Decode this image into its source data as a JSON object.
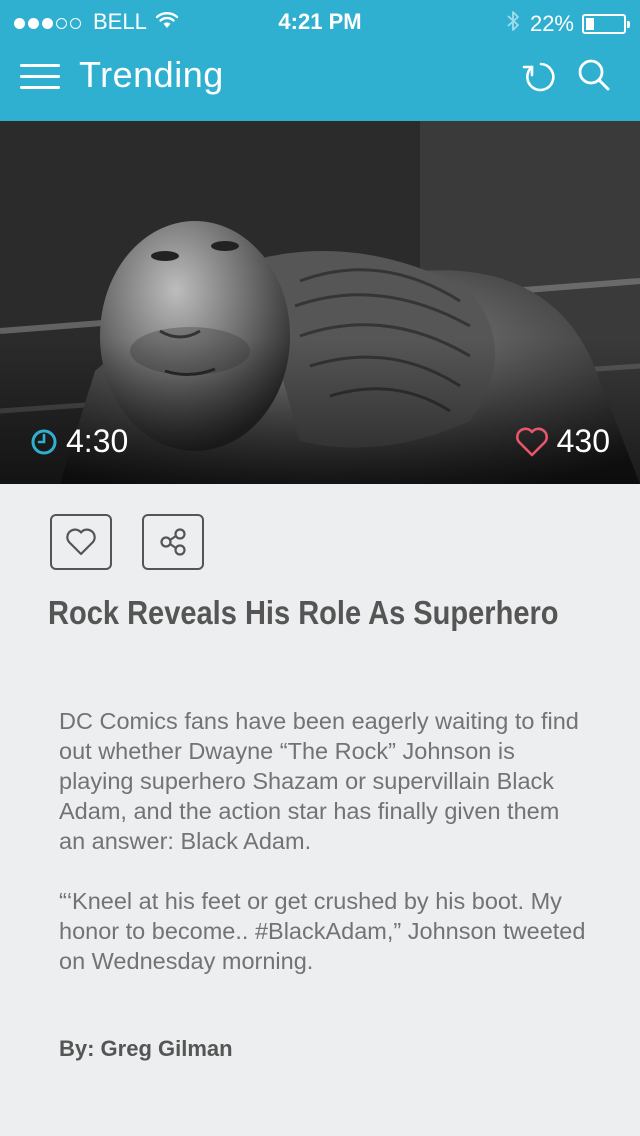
{
  "status_bar": {
    "carrier": "BELL",
    "time": "4:21 PM",
    "battery_percent": "22%",
    "battery_level": 0.22,
    "signal_bars": 3,
    "signal_max": 5,
    "icons": [
      "signal-dots-icon",
      "wifi-icon",
      "bluetooth-icon",
      "battery-icon"
    ]
  },
  "navbar": {
    "title": "Trending",
    "icons": [
      "menu-icon",
      "refresh-icon",
      "search-icon"
    ]
  },
  "article": {
    "duration": "4:30",
    "likes": "430",
    "title": "Rock Reveals His Role As Superhero",
    "paragraphs": [
      "DC Comics fans have been eagerly waiting to find out whether Dwayne “The Rock” Johnson is playing superhero Shazam or supervillain Black Adam, and the action star has finally given them an answer: Black Adam.",
      "“‘Kneel at his feet or get crushed by his boot. My honor to become.. #BlackAdam,” Johnson tweeted on Wednesday morning."
    ],
    "author": "By: Greg Gilman"
  },
  "colors": {
    "accent": "#2fb0d1",
    "heart": "#e8566b",
    "background": "#eceeef",
    "title_text": "#555555",
    "body_text": "#737373"
  }
}
